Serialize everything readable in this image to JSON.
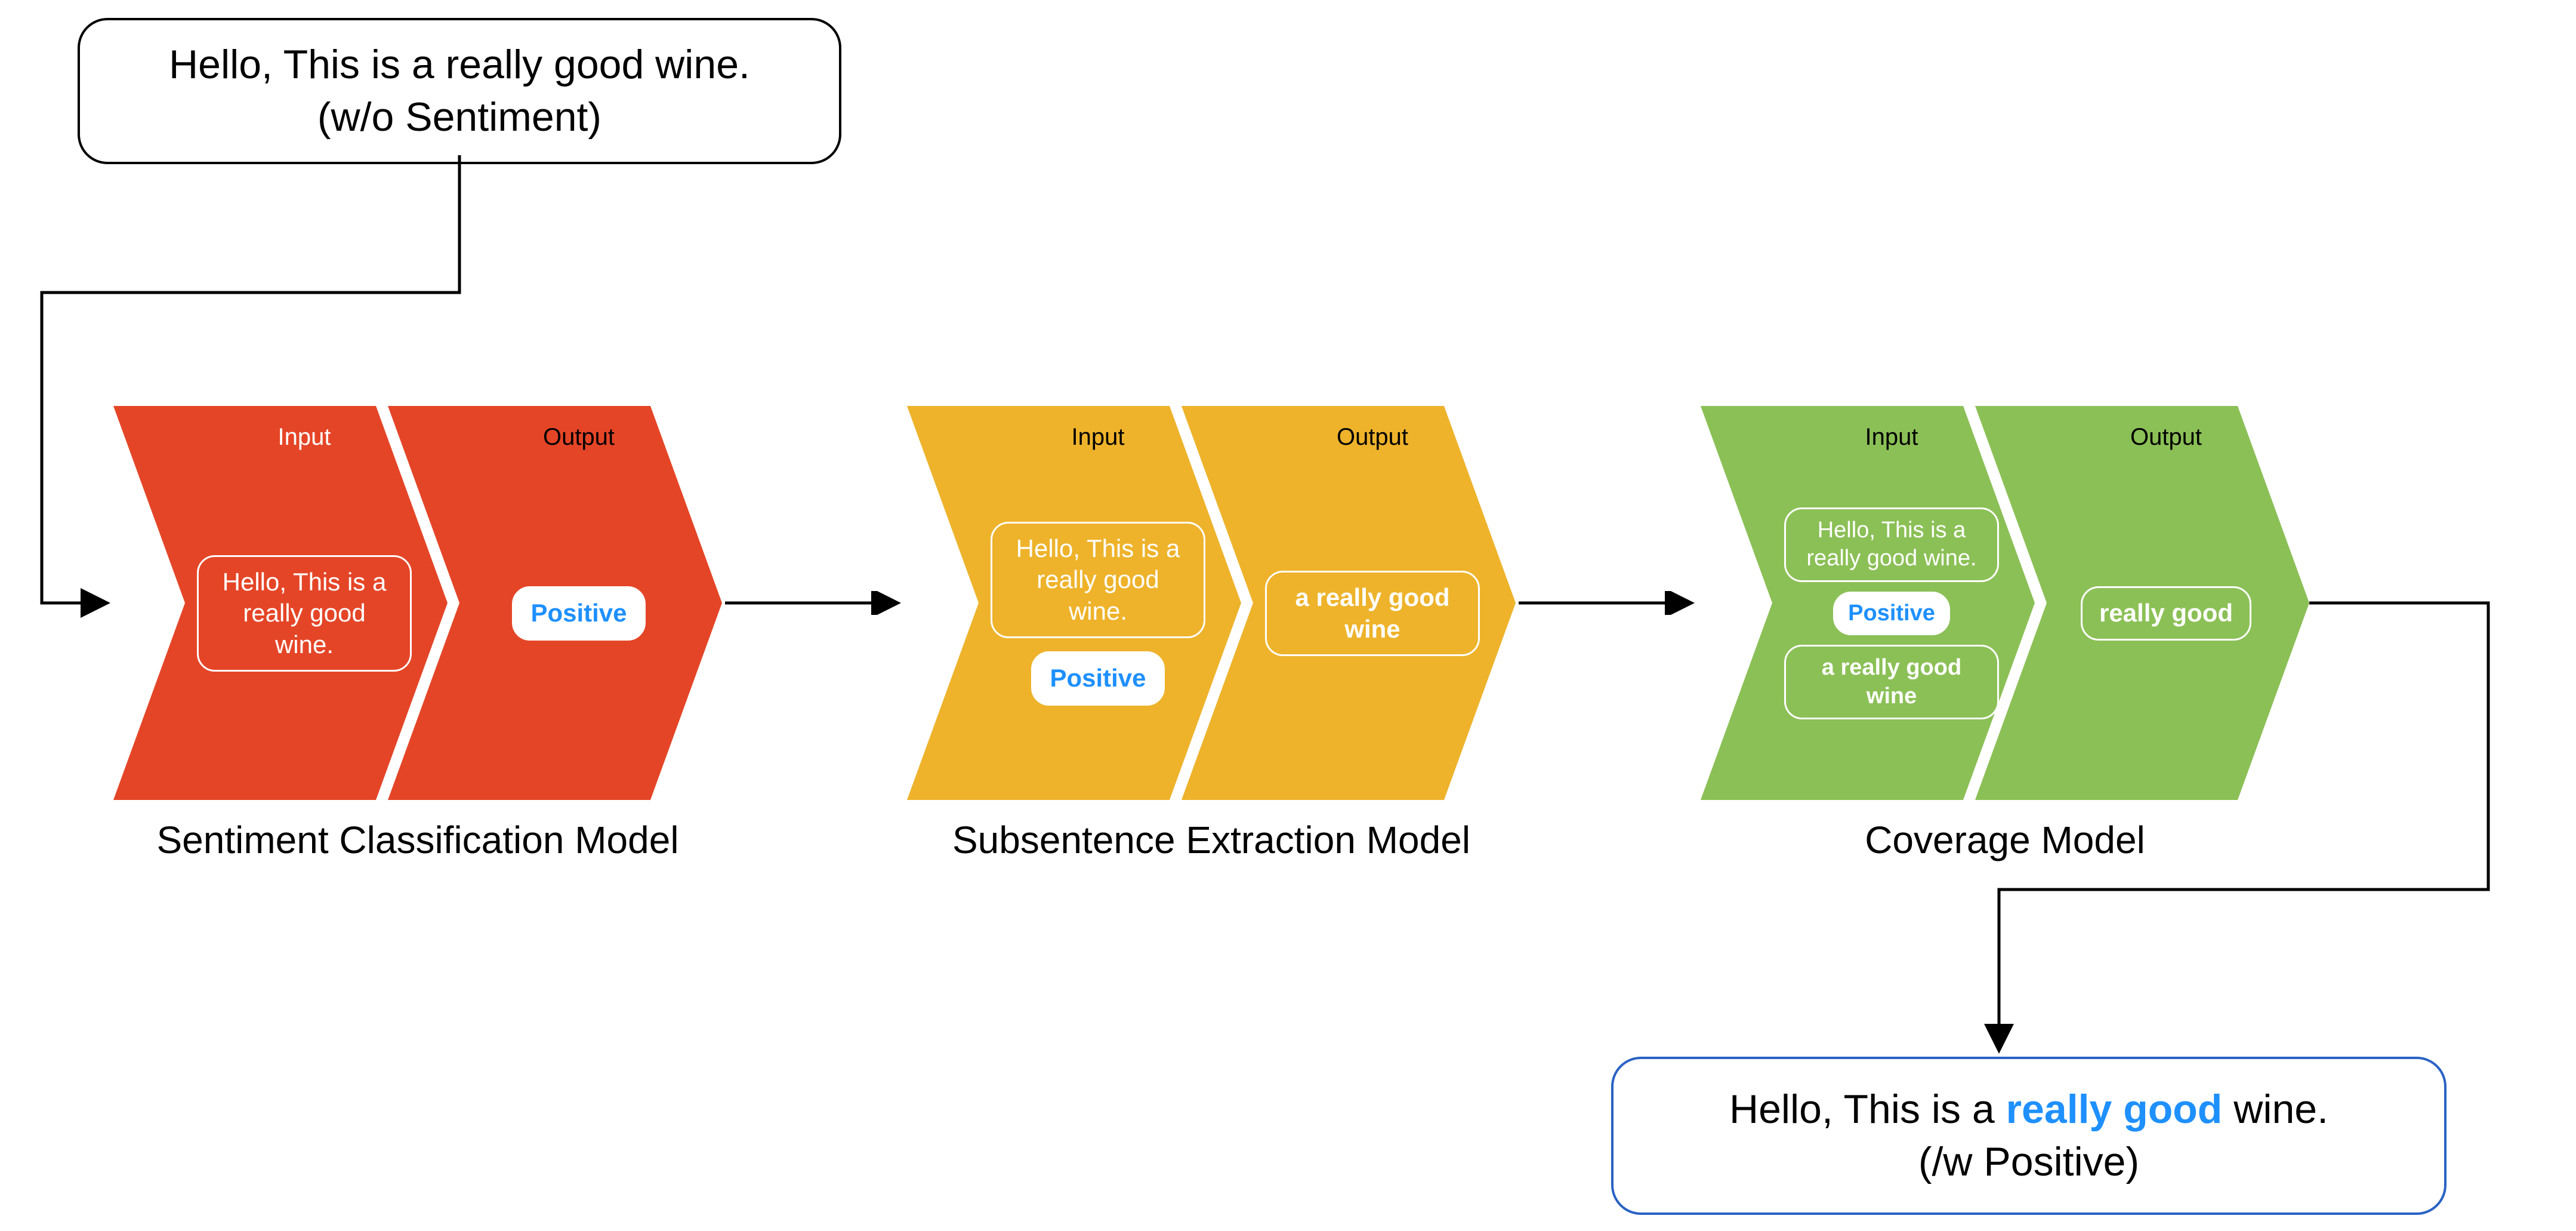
{
  "input_box": {
    "line1": "Hello, This is a really good wine.",
    "line2": "(w/o Sentiment)"
  },
  "stage1": {
    "title": "Sentiment Classification Model",
    "input_header": "Input",
    "output_header": "Output",
    "input_text": "Hello, This is a really good wine.",
    "output_text": "Positive",
    "color": "#e54527"
  },
  "stage2": {
    "title": "Subsentence Extraction Model",
    "input_header": "Input",
    "output_header": "Output",
    "input_text": "Hello, This is a really good wine.",
    "input_label": "Positive",
    "output_text": "a really good wine",
    "color": "#eeb32b"
  },
  "stage3": {
    "title": "Coverage Model",
    "input_header": "Input",
    "output_header": "Output",
    "input_text": "Hello, This is a really good wine.",
    "input_label": "Positive",
    "input_sub": "a really good wine",
    "output_text": "really good",
    "color": "#8bc056"
  },
  "output_box": {
    "prefix": "Hello, This is a ",
    "highlight": "really good",
    "suffix": " wine.",
    "line2": "(/w Positive)"
  }
}
